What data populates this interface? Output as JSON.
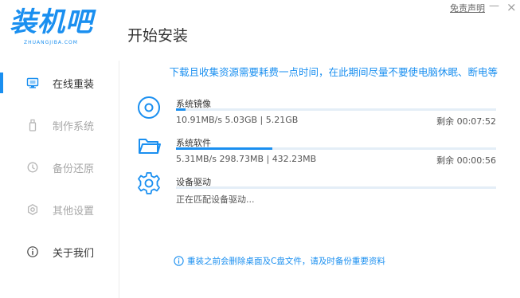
{
  "header": {
    "logo_text": "装机吧",
    "logo_sub": "ZHUANGJIBA.COM",
    "title": "开始安装",
    "disclaimer": "免责声明",
    "minimize": "—",
    "close": "×"
  },
  "sidebar": {
    "items": [
      {
        "label": "在线重装",
        "icon": "monitor-icon",
        "state": "active"
      },
      {
        "label": "制作系统",
        "icon": "usb-icon",
        "state": "disabled"
      },
      {
        "label": "备份还原",
        "icon": "backup-icon",
        "state": "disabled"
      },
      {
        "label": "其他设置",
        "icon": "settings-icon",
        "state": "disabled"
      },
      {
        "label": "关于我们",
        "icon": "info-icon",
        "state": "normal"
      }
    ]
  },
  "notice": "下载且收集资源需要耗费一点时间，在此期间尽量不要使电脑休眠、断电等",
  "tasks": [
    {
      "name": "系统镜像",
      "icon": "disc-icon",
      "stat": "10.91MB/s 5.03GB | 5.21GB",
      "remaining": "剩余 00:07:52",
      "progress": 0.03
    },
    {
      "name": "系统软件",
      "icon": "folder-icon",
      "stat": "5.31MB/s 298.73MB | 432.23MB",
      "remaining": "剩余 00:00:56",
      "progress": 0.3
    },
    {
      "name": "设备驱动",
      "icon": "gear-icon",
      "stat": "正在匹配设备驱动...",
      "remaining": "",
      "progress": 0.0
    }
  ],
  "warning": "重装之前会删除桌面及C盘文件，请及时备份重要资料",
  "colors": {
    "accent": "#1a8ff0",
    "track": "#e4eef7",
    "text": "#333333",
    "muted": "#a7a7a7"
  }
}
